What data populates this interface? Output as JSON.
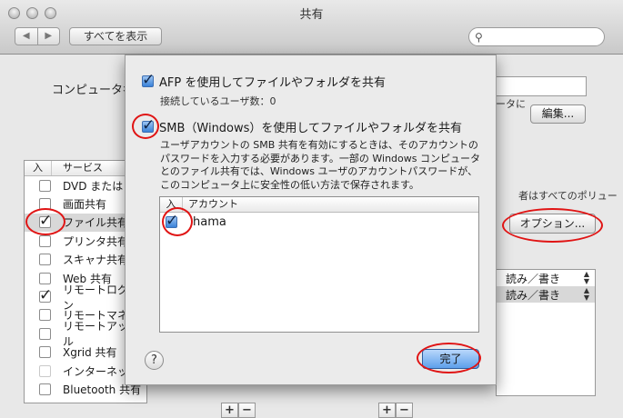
{
  "window": {
    "title": "共有",
    "nav_back": "◀",
    "nav_forward": "▶",
    "show_all": "すべてを表示",
    "search_icon": "magnifier-icon"
  },
  "background": {
    "computer_label": "コンピュータ名",
    "computer_note": "ータに",
    "edit_button": "編集...",
    "access_text": "者はすべてのポリュー",
    "options_button": "オプション...",
    "services_header": {
      "on": "入",
      "service": "サービス"
    },
    "services": [
      {
        "label": "DVD または",
        "checked": false,
        "selected": false
      },
      {
        "label": "画面共有",
        "checked": false,
        "selected": false
      },
      {
        "label": "ファイル共有",
        "checked": true,
        "selected": true
      },
      {
        "label": "プリンタ共有",
        "checked": false,
        "selected": false
      },
      {
        "label": "スキャナ共有",
        "checked": false,
        "selected": false
      },
      {
        "label": "Web 共有",
        "checked": false,
        "selected": false
      },
      {
        "label": "リモートログイン",
        "checked": true,
        "selected": false
      },
      {
        "label": "リモートマネ",
        "checked": false,
        "selected": false
      },
      {
        "label": "リモートアップル",
        "checked": false,
        "selected": false
      },
      {
        "label": "Xgrid 共有",
        "checked": false,
        "selected": false
      },
      {
        "label": "インターネット",
        "checked": false,
        "selected": false,
        "disabled": true
      },
      {
        "label": "Bluetooth 共有",
        "checked": false,
        "selected": false
      }
    ],
    "permissions": [
      "読み／書き",
      "読み／書き"
    ],
    "plus_label": "+",
    "minus_label": "−"
  },
  "sheet": {
    "afp_label": "AFP を使用してファイルやフォルダを共有",
    "afp_checked": true,
    "users_label": "接続しているユーザ数：0",
    "smb_label": "SMB（Windows）を使用してファイルやフォルダを共有",
    "smb_checked": true,
    "smb_description": "ユーザアカウントの SMB 共有を有効にするときは、そのアカウントのパスワードを入力する必要があります。一部の Windows コンピュータとのファイル共有では、Windows ユーザのアカウントパスワードが、このコンピュータ上に安全性の低い方法で保存されます。",
    "accounts_header": {
      "on": "入",
      "account": "アカウント"
    },
    "accounts": [
      {
        "name": "hama",
        "checked": true
      }
    ],
    "help_label": "?",
    "done_button": "完了"
  },
  "colors": {
    "annotation": "#e01414",
    "accent": "#3a82d8"
  }
}
